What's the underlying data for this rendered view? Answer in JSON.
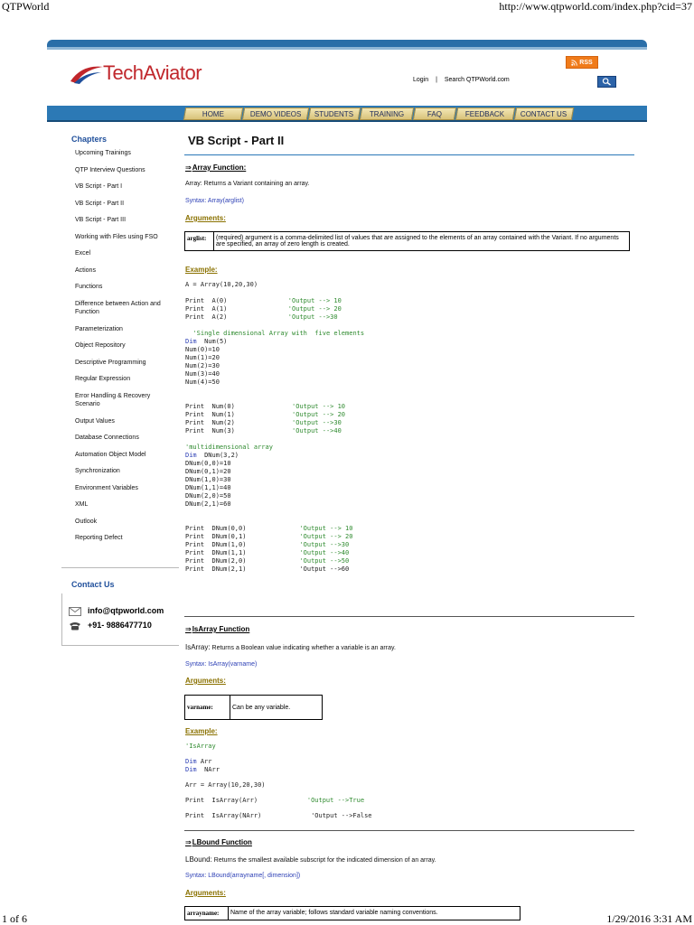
{
  "print": {
    "title": "QTPWorld",
    "url": "http://www.qtpworld.com/index.php?cid=37",
    "page": "1 of 6",
    "datetime": "1/29/2016 3:31 AM"
  },
  "header": {
    "logo_text": "TechAviator",
    "rss_label": "RSS",
    "login": "Login",
    "separator": "|",
    "search_label": "Search QTPWorld.com"
  },
  "nav": [
    "HOME",
    "DEMO VIDEOS",
    "STUDENTS",
    "TRAINING",
    "FAQ",
    "FEEDBACK",
    "CONTACT US"
  ],
  "sidebar": {
    "heading": "Chapters",
    "items": [
      "Upcoming Trainings",
      "QTP Interview Questions",
      "VB Script - Part I",
      "VB Script - Part II",
      "VB Script - Part III",
      "Working with Files using FSO",
      "Excel",
      "Actions",
      "Functions",
      "Difference between Action and",
      "Function",
      "Parameterization",
      "Object Repository",
      "Descriptive Programming",
      "Regular Expression",
      "Error Handling & Recovery",
      "Scenario",
      "Output Values",
      "Database Connections",
      "Automation Object Model",
      "Synchronization",
      "Environment Variables",
      "XML",
      "Outlook",
      "Reporting Defect"
    ],
    "contact_heading": "Contact Us",
    "email": "info@qtpworld.com",
    "phone": "+91- 9886477710"
  },
  "content": {
    "title": "VB Script - Part II",
    "array": {
      "heading": "Array Function:",
      "description": "Array: Returns a Variant containing an array.",
      "syntax": "Syntax: Array(arglist)",
      "arguments_label": "Arguments:",
      "arg_name": "arglist:",
      "arg_desc": "(required) argument is a comma-delimited list of values that are assigned to the elements of an array contained with the Variant. If no arguments are specified, an array of zero length is created.",
      "example_label": "Example:"
    },
    "isarray": {
      "heading": "IsArray Function",
      "desc_lead": "IsArray:",
      "description": "Returns a Boolean value indicating whether a variable is an array.",
      "syntax": "Syntax: IsArray(varname)",
      "arguments_label": "Arguments:",
      "arg_name": "varname:",
      "arg_desc": "Can be any variable.",
      "example_label": "Example:"
    },
    "lbound": {
      "heading": "LBound Function",
      "desc_lead": "LBound:",
      "description": "Returns the smallest available subscript for the indicated dimension of an array.",
      "syntax": "Syntax: LBound(arrayname[, dimension])",
      "arguments_label": "Arguments:",
      "arg_name": "arrayname:",
      "arg_desc": "Name of the array variable; follows standard variable naming conventions."
    }
  }
}
